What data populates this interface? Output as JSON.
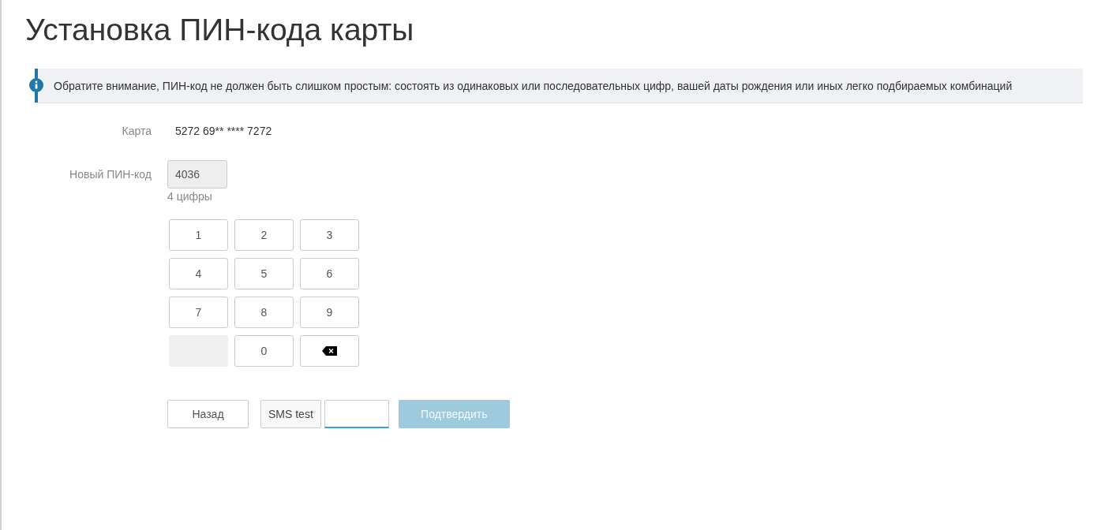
{
  "title": "Установка ПИН-кода карты",
  "notice": "Обратите внимание, ПИН-код не должен быть слишком простым: состоять из одинаковых или последовательных цифр, вашей даты рождения или иных легко подбираемых комбинаций",
  "card": {
    "label": "Карта",
    "value": "5272 69** **** 7272"
  },
  "pin": {
    "label": "Новый ПИН-код",
    "value": "4036",
    "hint": "4 цифры"
  },
  "keypad": [
    {
      "kind": "digit",
      "label": "1"
    },
    {
      "kind": "digit",
      "label": "2"
    },
    {
      "kind": "digit",
      "label": "3"
    },
    {
      "kind": "digit",
      "label": "4"
    },
    {
      "kind": "digit",
      "label": "5"
    },
    {
      "kind": "digit",
      "label": "6"
    },
    {
      "kind": "digit",
      "label": "7"
    },
    {
      "kind": "digit",
      "label": "8"
    },
    {
      "kind": "digit",
      "label": "9"
    },
    {
      "kind": "blank"
    },
    {
      "kind": "digit",
      "label": "0"
    },
    {
      "kind": "backspace"
    }
  ],
  "back_button": "Назад",
  "sms": {
    "label": "SMS test"
  },
  "confirm_button": {
    "label": "Подтвердить",
    "disabled": true
  }
}
